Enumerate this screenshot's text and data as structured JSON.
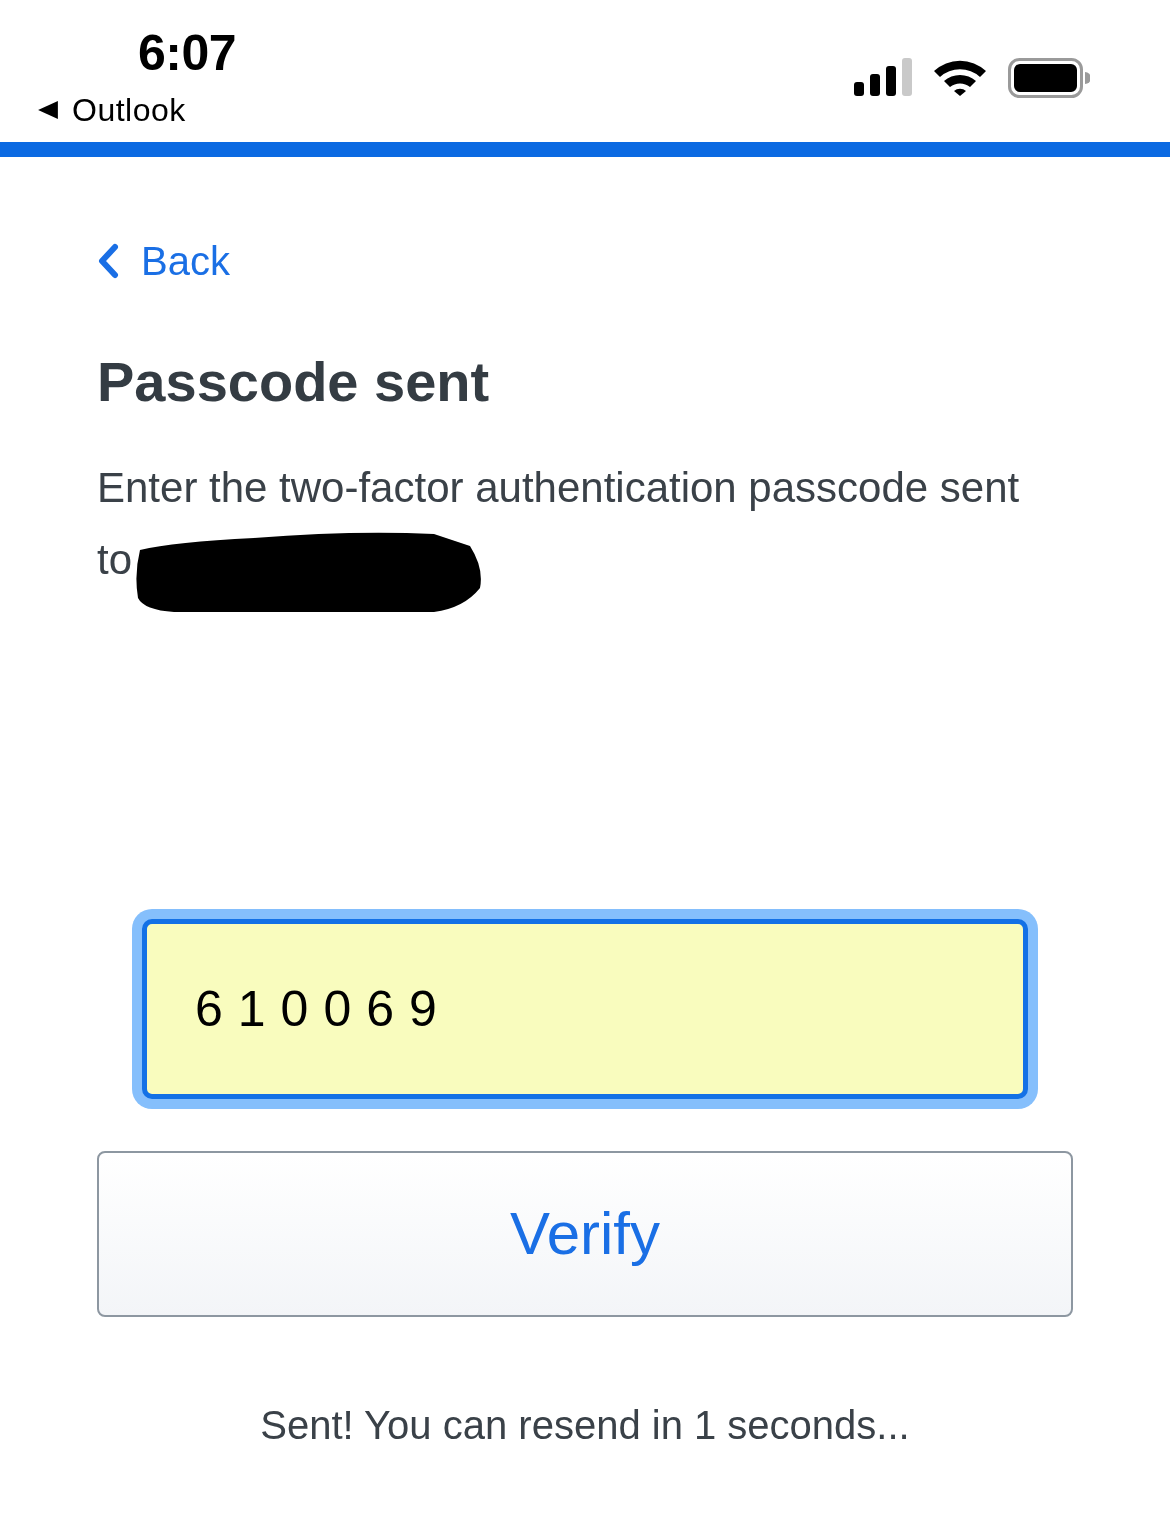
{
  "status_bar": {
    "time": "6:07",
    "back_app": "Outlook"
  },
  "back_link": {
    "label": "Back"
  },
  "title": "Passcode sent",
  "instructions": [
    "Enter the two-factor authentication passcode sent",
    "to"
  ],
  "passcode_field": {
    "value": "610069",
    "focused": true
  },
  "verify_button": {
    "label": "Verify"
  },
  "resend_message": "Sent! You can resend in 1 seconds..."
}
